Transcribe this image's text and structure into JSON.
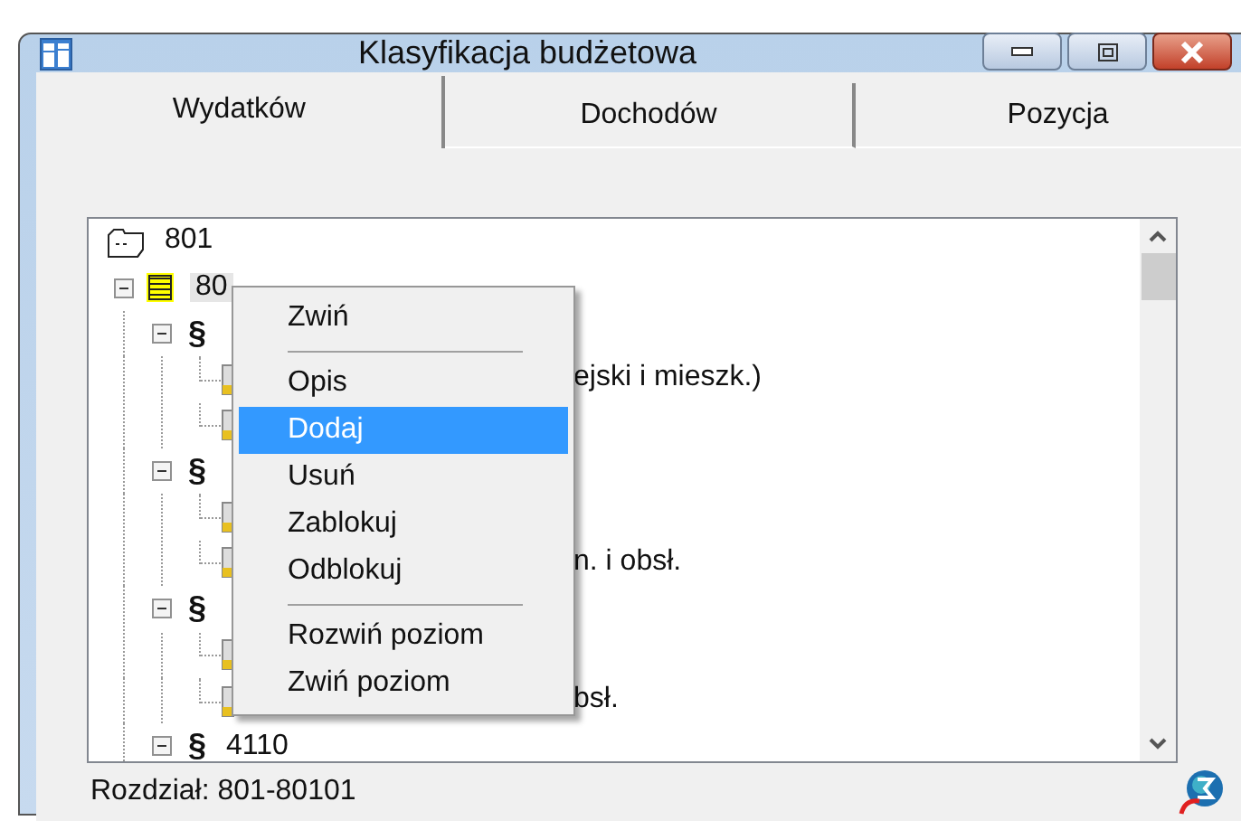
{
  "window": {
    "title": "Klasyfikacja budżetowa"
  },
  "tabs": [
    {
      "label": "Wydatków",
      "selected": true
    },
    {
      "label": "Dochodów",
      "selected": false
    },
    {
      "label": "Pozycja",
      "selected": false
    }
  ],
  "tree": {
    "label": "801",
    "kind": "chapter",
    "children": [
      {
        "label": "80",
        "kind": "section",
        "expanded": true,
        "selected": true,
        "children": [
          {
            "kind": "paragraph",
            "symbol": "§",
            "expanded": true,
            "children": [
              {
                "kind": "item",
                "label": "ejski i mieszk.)"
              },
              {
                "kind": "item"
              }
            ]
          },
          {
            "kind": "paragraph",
            "symbol": "§",
            "expanded": true,
            "children": [
              {
                "kind": "item"
              },
              {
                "kind": "item",
                "label": "n. i obsł."
              }
            ]
          },
          {
            "kind": "paragraph",
            "symbol": "§",
            "expanded": true,
            "children": [
              {
                "kind": "item"
              },
              {
                "kind": "item",
                "label": "bsł."
              }
            ]
          },
          {
            "kind": "paragraph",
            "symbol": "§",
            "label": "4110",
            "expanded": true
          }
        ]
      }
    ]
  },
  "context_menu": {
    "items": [
      {
        "kind": "item",
        "label": "Zwiń",
        "selected": false
      },
      {
        "kind": "separator"
      },
      {
        "kind": "item",
        "label": "Opis",
        "selected": false
      },
      {
        "kind": "item",
        "label": "Dodaj",
        "selected": true
      },
      {
        "kind": "item",
        "label": "Usuń",
        "selected": false
      },
      {
        "kind": "item",
        "label": "Zablokuj",
        "selected": false
      },
      {
        "kind": "item",
        "label": "Odblokuj",
        "selected": false
      },
      {
        "kind": "separator"
      },
      {
        "kind": "item",
        "label": "Rozwiń poziom",
        "selected": false
      },
      {
        "kind": "item",
        "label": "Zwiń poziom",
        "selected": false
      }
    ]
  },
  "status_bar": {
    "text": "Rozdział: 801-80101"
  }
}
